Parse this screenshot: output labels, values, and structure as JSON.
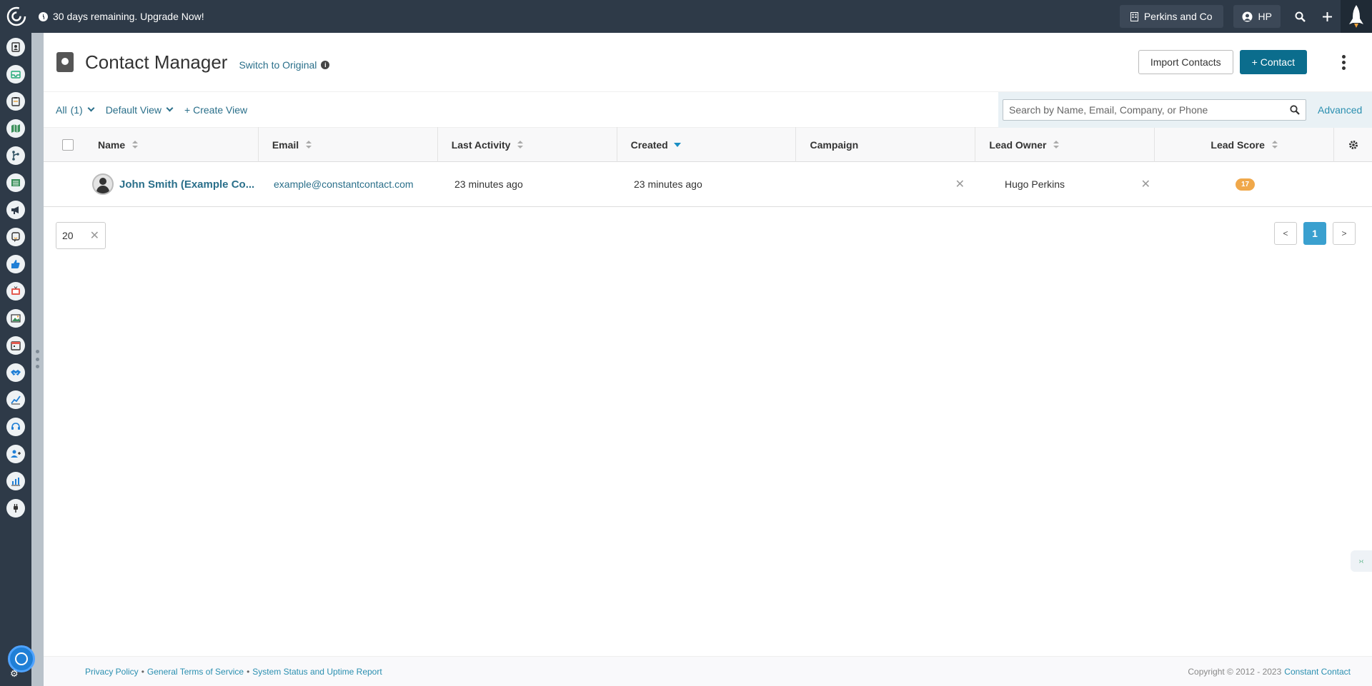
{
  "topbar": {
    "trial_text": "30 days remaining. Upgrade Now!",
    "company": "Perkins and Co",
    "user_initials": "HP"
  },
  "header": {
    "title": "Contact Manager",
    "switch_link": "Switch to Original",
    "import_button": "Import Contacts",
    "add_contact_button": "+ Contact"
  },
  "filters": {
    "all_label": "All",
    "all_count": "(1)",
    "view_label": "Default View",
    "create_view": "+ Create View",
    "search_placeholder": "Search by Name, Email, Company, or Phone",
    "advanced": "Advanced"
  },
  "table": {
    "columns": [
      "Name",
      "Email",
      "Last Activity",
      "Created",
      "Campaign",
      "Lead Owner",
      "Lead Score"
    ],
    "sorted_column": "Created",
    "rows": [
      {
        "name": "John Smith (Example Co...",
        "email": "example@constantcontact.com",
        "last_activity": "23 minutes ago",
        "created": "23 minutes ago",
        "campaign": "",
        "lead_owner": "Hugo Perkins",
        "lead_score": "17"
      }
    ]
  },
  "pagination": {
    "per_page": "20",
    "prev": "<",
    "current": "1",
    "next": ">"
  },
  "footer": {
    "links": [
      "Privacy Policy",
      "General Terms of Service",
      "System Status and Uptime Report"
    ],
    "copyright": "Copyright © 2012 - 2023",
    "brand": "Constant Contact"
  },
  "colors": {
    "topbar": "#2e3a48",
    "primary": "#0b6d8d",
    "link": "#2a6f8a",
    "score_badge": "#f0a84a",
    "page_active": "#3aa0cf"
  },
  "sidebar_icons": [
    "contacts-icon",
    "inbox-icon",
    "clipboard-icon",
    "map-icon",
    "pipeline-icon",
    "list-icon",
    "megaphone-icon",
    "chat-icon",
    "thumbs-up-icon",
    "tv-icon",
    "image-icon",
    "calendar-icon",
    "handshake-icon",
    "trend-icon",
    "headset-icon",
    "add-user-icon",
    "bar-chart-icon",
    "plug-icon"
  ]
}
